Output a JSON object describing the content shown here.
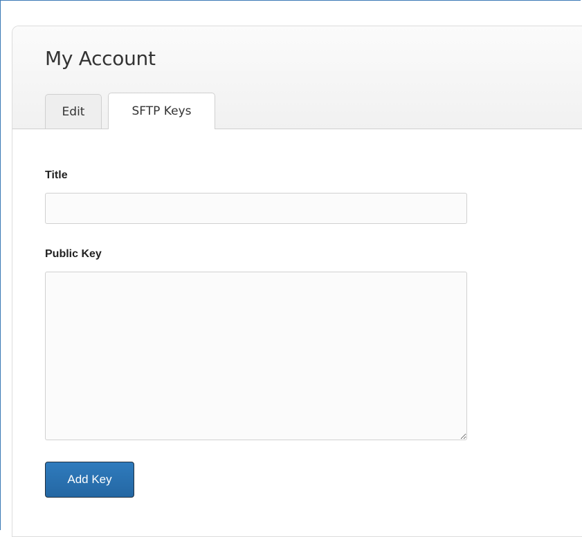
{
  "header": {
    "title": "My Account"
  },
  "tabs": [
    {
      "label": "Edit",
      "active": false
    },
    {
      "label": "SFTP Keys",
      "active": true
    }
  ],
  "form": {
    "title_label": "Title",
    "title_value": "",
    "public_key_label": "Public Key",
    "public_key_value": "",
    "submit_label": "Add Key"
  },
  "colors": {
    "frame_border": "#3a78b5",
    "button_bg": "#2a70b0",
    "button_border": "#1f2f3f",
    "input_bg": "#fbfbfb",
    "header_bg": "#f4f4f4"
  }
}
